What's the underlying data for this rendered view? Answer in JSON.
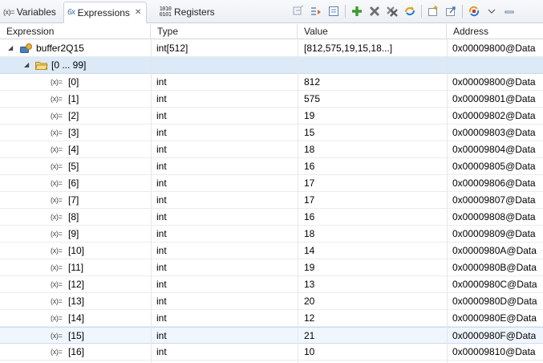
{
  "tabs": [
    {
      "label": "Variables",
      "icon_text": "(x)=",
      "close": ""
    },
    {
      "label": "Expressions",
      "icon_text": "6x",
      "close": "✕"
    },
    {
      "label": "Registers",
      "icon_text": "1010\n0101",
      "close": ""
    }
  ],
  "toolbar": {
    "icons": [
      "collapse-all-icon",
      "show-type-names-icon",
      "collapse-icon",
      "add-expression-icon",
      "remove-icon",
      "remove-all-icon",
      "refresh-icon",
      "new-view-icon",
      "export-icon",
      "pin-icon",
      "view-menu-icon",
      "minimize-icon",
      "maximize-icon"
    ]
  },
  "columns": {
    "expression": "Expression",
    "type": "Type",
    "value": "Value",
    "address": "Address"
  },
  "root": {
    "name": "buffer2Q15",
    "type": "int[512]",
    "value": "[812,575,19,15,18...]",
    "address": "0x00009800@Data"
  },
  "group": {
    "label": "[0 ... 99]"
  },
  "var_icon_text": "(x)=",
  "rows": [
    {
      "name": "[0]",
      "type": "int",
      "value": "812",
      "address": "0x00009800@Data"
    },
    {
      "name": "[1]",
      "type": "int",
      "value": "575",
      "address": "0x00009801@Data"
    },
    {
      "name": "[2]",
      "type": "int",
      "value": "19",
      "address": "0x00009802@Data"
    },
    {
      "name": "[3]",
      "type": "int",
      "value": "15",
      "address": "0x00009803@Data"
    },
    {
      "name": "[4]",
      "type": "int",
      "value": "18",
      "address": "0x00009804@Data"
    },
    {
      "name": "[5]",
      "type": "int",
      "value": "16",
      "address": "0x00009805@Data"
    },
    {
      "name": "[6]",
      "type": "int",
      "value": "17",
      "address": "0x00009806@Data"
    },
    {
      "name": "[7]",
      "type": "int",
      "value": "17",
      "address": "0x00009807@Data"
    },
    {
      "name": "[8]",
      "type": "int",
      "value": "16",
      "address": "0x00009808@Data"
    },
    {
      "name": "[9]",
      "type": "int",
      "value": "18",
      "address": "0x00009809@Data"
    },
    {
      "name": "[10]",
      "type": "int",
      "value": "14",
      "address": "0x0000980A@Data"
    },
    {
      "name": "[11]",
      "type": "int",
      "value": "19",
      "address": "0x0000980B@Data"
    },
    {
      "name": "[12]",
      "type": "int",
      "value": "13",
      "address": "0x0000980C@Data"
    },
    {
      "name": "[13]",
      "type": "int",
      "value": "20",
      "address": "0x0000980D@Data"
    },
    {
      "name": "[14]",
      "type": "int",
      "value": "12",
      "address": "0x0000980E@Data"
    },
    {
      "name": "[15]",
      "type": "int",
      "value": "21",
      "address": "0x0000980F@Data"
    },
    {
      "name": "[16]",
      "type": "int",
      "value": "10",
      "address": "0x00009810@Data"
    }
  ],
  "colors": {
    "group_row": "#dce9f7",
    "hover_row": "#f0f6fd",
    "add_icon": "#3a9b2f",
    "remove_icon": "#666666"
  }
}
